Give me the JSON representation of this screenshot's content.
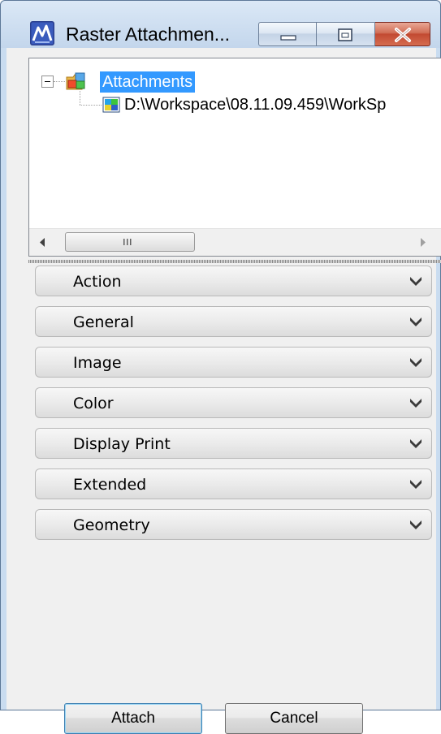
{
  "window": {
    "title": "Raster Attachmen...",
    "app_icon": "microstation-icon",
    "controls": [
      "minimize-icon",
      "maximize-icon",
      "close-icon"
    ],
    "accent": "#3399ff",
    "close_color": "#c24a32"
  },
  "tree": {
    "root": {
      "label": "Attachments",
      "icon": "folder-attachments-icon",
      "expanded": true,
      "selected": true
    },
    "children": [
      {
        "label": "D:\\Workspace\\08.11.09.459\\WorkSp",
        "icon": "raster-image-icon"
      }
    ],
    "scrollbar": {
      "grip": "III"
    }
  },
  "panels": [
    {
      "label": "Action"
    },
    {
      "label": "General"
    },
    {
      "label": "Image"
    },
    {
      "label": "Color"
    },
    {
      "label": "Display Print"
    },
    {
      "label": "Extended"
    },
    {
      "label": "Geometry"
    }
  ],
  "buttons": {
    "attach": "Attach",
    "cancel": "Cancel"
  }
}
